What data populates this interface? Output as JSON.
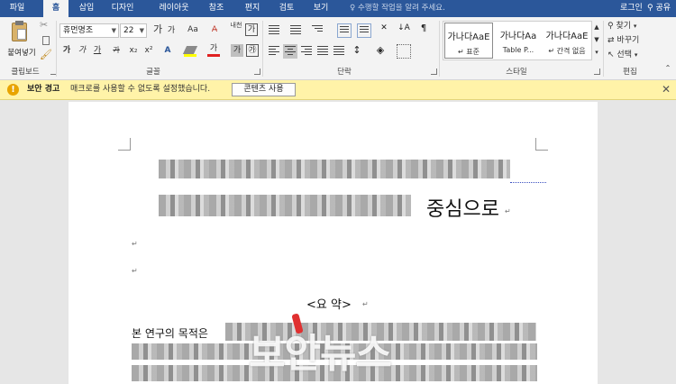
{
  "tabs": [
    "파일",
    "홈",
    "삽입",
    "디자인",
    "레이아웃",
    "참조",
    "편지",
    "검토",
    "보기"
  ],
  "active_tab": "홈",
  "tell_me": "수행할 작업을 알려 주세요.",
  "account": {
    "login": "로그인",
    "share": "공유"
  },
  "ribbon": {
    "clipboard": {
      "paste": "붙여넣기",
      "label": "클립보드"
    },
    "font": {
      "name": "휴먼명조",
      "size": "22",
      "label": "글꼴",
      "grow": "가",
      "shrink": "가",
      "case": "Aa",
      "bold": "가",
      "italic": "가",
      "underline": "가",
      "strike": "가",
      "sub": "x₂",
      "sup": "x²",
      "phonetic": "내천",
      "border_char": "가",
      "font_color": "가"
    },
    "paragraph": {
      "label": "단락"
    },
    "styles": {
      "label": "스타일",
      "cards": [
        {
          "preview": "가나다AaE",
          "name": "↵ 표준"
        },
        {
          "preview": "가나다Aa",
          "name": "Table P..."
        },
        {
          "preview": "가나다AaE",
          "name": "↵ 간격 없음"
        }
      ]
    },
    "editing": {
      "label": "편집",
      "find": "찾기",
      "replace": "바꾸기",
      "select": "선택"
    }
  },
  "security_bar": {
    "title": "보안 경고",
    "message": "매크로를 사용할 수 없도록 설정했습니다.",
    "button": "콘텐츠 사용"
  },
  "document": {
    "heading_tail": "중심으로",
    "abstract_title": "<요  약>",
    "body_start": "본 연구의 목적은"
  },
  "watermark": "보안뉴스"
}
